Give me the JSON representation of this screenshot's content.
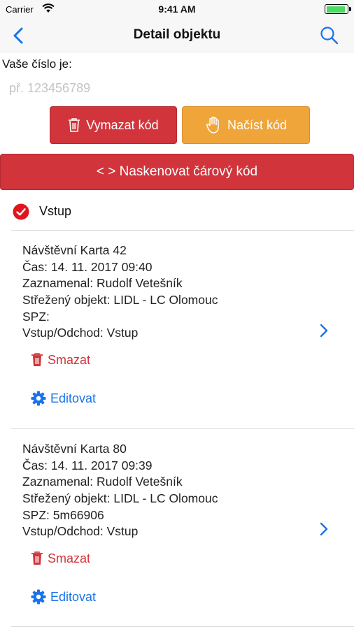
{
  "status_bar": {
    "carrier": "Carrier",
    "time": "9:41 AM",
    "icons": [
      "wifi-icon",
      "battery-icon"
    ]
  },
  "nav": {
    "title": "Detail objektu",
    "back_icon": "chevron-left-icon",
    "search_icon": "search-icon"
  },
  "code": {
    "label": "Vaše číslo je:",
    "placeholder": "př. 123456789"
  },
  "buttons": {
    "vymazat": "Vymazat kód",
    "nacist": "Načíst kód",
    "scan": "< > Naskenovat čárový kód"
  },
  "colors": {
    "red": "#d1343b",
    "orange": "#f0a53a",
    "blue": "#1a73e8"
  },
  "filter": {
    "label": "Vstup",
    "checked": true
  },
  "records": [
    {
      "title": "Návštěvní Karta 42",
      "time": "Čas: 14. 11. 2017 09:40",
      "recorded_by": "Zaznamenal: Rudolf Vetešník",
      "object": "Střežený objekt: LIDL - LC Olomouc",
      "spz": "SPZ:",
      "direction": "Vstup/Odchod: Vstup",
      "delete_label": "Smazat",
      "edit_label": "Editovat"
    },
    {
      "title": "Návštěvní Karta 80",
      "time": "Čas: 14. 11. 2017 09:39",
      "recorded_by": "Zaznamenal: Rudolf Vetešník",
      "object": "Střežený objekt: LIDL - LC Olomouc",
      "spz": "SPZ: 5m66906",
      "direction": "Vstup/Odchod: Vstup",
      "delete_label": "Smazat",
      "edit_label": "Editovat"
    }
  ]
}
